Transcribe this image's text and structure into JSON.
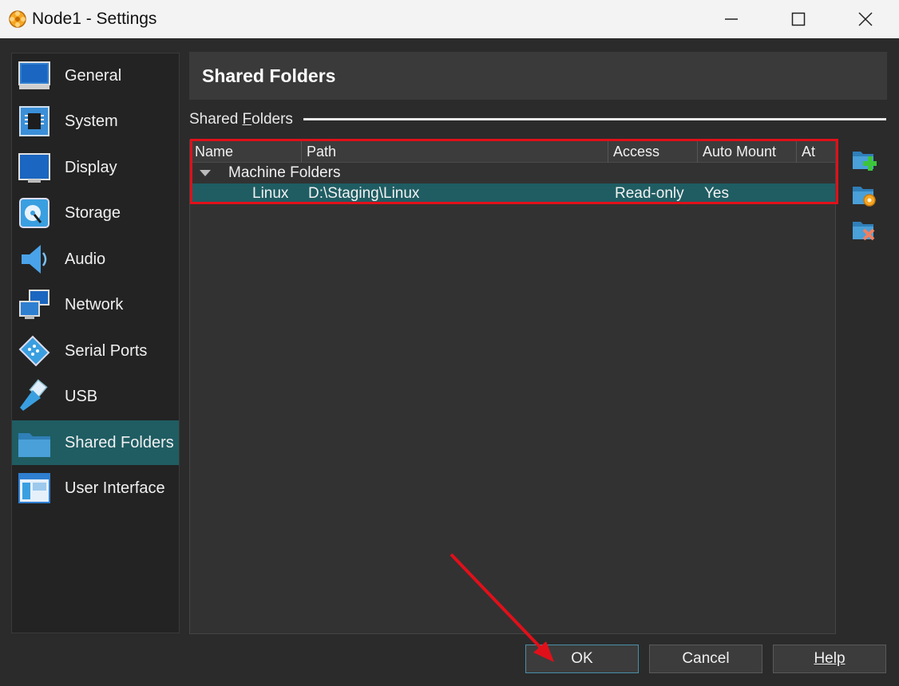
{
  "window": {
    "title": "Node1 - Settings",
    "controls": [
      "minimize",
      "maximize",
      "close"
    ]
  },
  "sidebar": {
    "items": [
      {
        "label": "General",
        "icon": "general-icon"
      },
      {
        "label": "System",
        "icon": "system-icon"
      },
      {
        "label": "Display",
        "icon": "display-icon"
      },
      {
        "label": "Storage",
        "icon": "storage-icon"
      },
      {
        "label": "Audio",
        "icon": "audio-icon"
      },
      {
        "label": "Network",
        "icon": "network-icon"
      },
      {
        "label": "Serial Ports",
        "icon": "serial-ports-icon"
      },
      {
        "label": "USB",
        "icon": "usb-icon"
      },
      {
        "label": "Shared Folders",
        "icon": "shared-folders-icon",
        "selected": true
      },
      {
        "label": "User Interface",
        "icon": "user-interface-icon"
      }
    ]
  },
  "page": {
    "title": "Shared Folders",
    "section_label": "Shared Folders",
    "section_label_mnemonic": "F"
  },
  "table": {
    "columns": [
      "Name",
      "Path",
      "Access",
      "Auto Mount",
      "At"
    ],
    "group": "Machine Folders",
    "rows": [
      {
        "name": "Linux",
        "path": "D:\\Staging\\Linux",
        "access": "Read-only",
        "auto_mount": "Yes",
        "at": ""
      }
    ]
  },
  "tools": [
    "add-folder-icon",
    "edit-folder-icon",
    "remove-folder-icon"
  ],
  "buttons": {
    "ok": "OK",
    "cancel": "Cancel",
    "help": "Help"
  },
  "colors": {
    "selection": "#1f5d63",
    "annotation": "#e0101a"
  }
}
